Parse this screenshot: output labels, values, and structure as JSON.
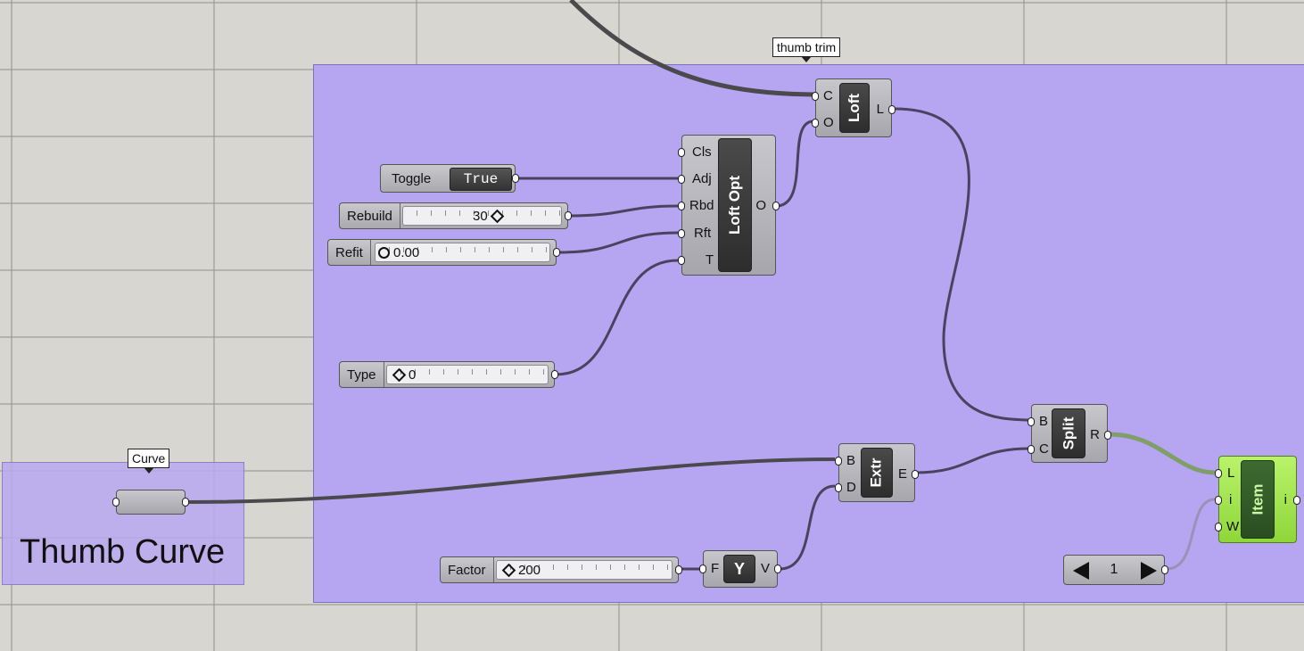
{
  "groups": {
    "main": {
      "callout": "thumb trim"
    },
    "thumb": {
      "callout": "Curve",
      "title": "Thumb Curve"
    }
  },
  "components": {
    "loft": {
      "name": "Loft",
      "inputs": [
        "C",
        "O"
      ],
      "outputs": [
        "L"
      ]
    },
    "loft_opt": {
      "name": "Loft Opt",
      "inputs": [
        "Cls",
        "Adj",
        "Rbd",
        "Rft",
        "T"
      ],
      "outputs": [
        "O"
      ]
    },
    "split": {
      "name": "Split",
      "inputs": [
        "B",
        "C"
      ],
      "outputs": [
        "R"
      ]
    },
    "extr": {
      "name": "Extr",
      "inputs": [
        "B",
        "D"
      ],
      "outputs": [
        "E"
      ]
    },
    "y_vec": {
      "name": "Y",
      "inputs": [
        "F"
      ],
      "outputs": [
        "V"
      ]
    },
    "item": {
      "name": "Item",
      "inputs": [
        "L",
        "i",
        "W"
      ],
      "outputs": [
        "i"
      ]
    }
  },
  "params": {
    "toggle": {
      "label": "Toggle",
      "value": "True"
    },
    "rebuild": {
      "label": "Rebuild",
      "value": "30"
    },
    "refit": {
      "label": "Refit",
      "value": "0.00"
    },
    "type": {
      "label": "Type",
      "value": "0"
    },
    "factor": {
      "label": "Factor",
      "value": "200"
    },
    "stepper": {
      "value": "1"
    }
  },
  "icons": {
    "stepper_left": "triangle-left-icon",
    "stepper_right": "triangle-right-icon"
  },
  "colors": {
    "canvas": "#d7d6d1",
    "group": "#b6a6f1",
    "wire": "#4a4360",
    "component": "#b7b7bc",
    "item_component": "#a6e655"
  }
}
